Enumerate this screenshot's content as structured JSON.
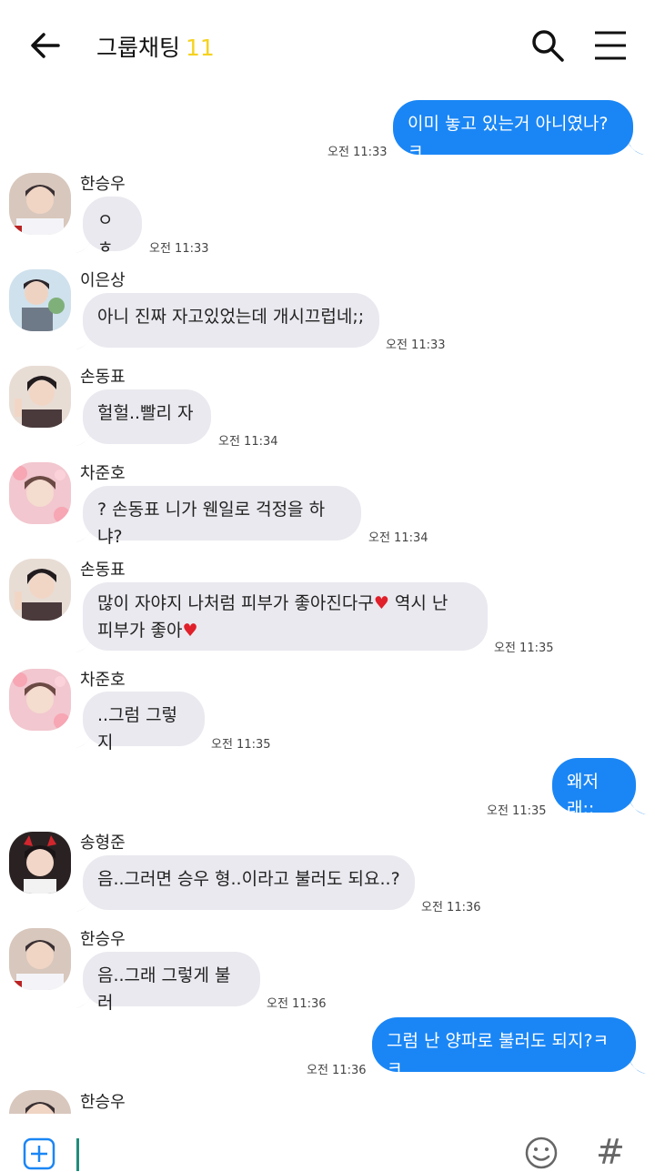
{
  "header": {
    "title": "그룹채팅",
    "member_count": "11"
  },
  "messages": [
    {
      "side": "out",
      "text": "이미 놓고 있는거 아니였나?ㅋ",
      "time": "오전 11:33"
    },
    {
      "side": "in",
      "sender": "한승우",
      "text": "ㅇㅎ",
      "time": "오전 11:33"
    },
    {
      "side": "in",
      "sender": "이은상",
      "text": "아니 진짜 자고있었는데 개시끄럽네;;",
      "time": "오전 11:33"
    },
    {
      "side": "in",
      "sender": "손동표",
      "text": "헐헐..빨리 자",
      "time": "오전 11:34"
    },
    {
      "side": "in",
      "sender": "차준호",
      "text": "? 손동표 니가 웬일로 걱정을 하냐?",
      "time": "오전 11:34"
    },
    {
      "side": "in",
      "sender": "손동표",
      "text_line1": "많이 자야지 나처럼 피부가 좋아진다구",
      "text_line1_tail": " 역시 난",
      "text_line2": "피부가 좋아",
      "time": "오전 11:35"
    },
    {
      "side": "in",
      "sender": "차준호",
      "text": "..그럼 그렇지",
      "time": "오전 11:35"
    },
    {
      "side": "out",
      "text": "왜저래;;",
      "time": "오전 11:35"
    },
    {
      "side": "in",
      "sender": "송형준",
      "text": "음..그러면 승우 형..이라고 불러도 되요..?",
      "time": "오전 11:36"
    },
    {
      "side": "in",
      "sender": "한승우",
      "text": "음..그래 그렇게 불러",
      "time": "오전 11:36"
    },
    {
      "side": "out",
      "text": "그럼 난 양파로 불러도 되지?ㅋㅋ",
      "time": "오전 11:36"
    },
    {
      "side": "in",
      "sender": "한승우",
      "text": ""
    }
  ],
  "input": {
    "hash_symbol": "#"
  },
  "icons": {
    "back": "back-arrow-icon",
    "search": "search-icon",
    "menu": "menu-icon",
    "add": "plus-icon",
    "emoji": "emoji-icon",
    "hash": "hashtag-icon"
  },
  "colors": {
    "out_bubble": "#1a86f5",
    "in_bubble": "#e9e9ef",
    "accent_count": "#f5d220"
  }
}
